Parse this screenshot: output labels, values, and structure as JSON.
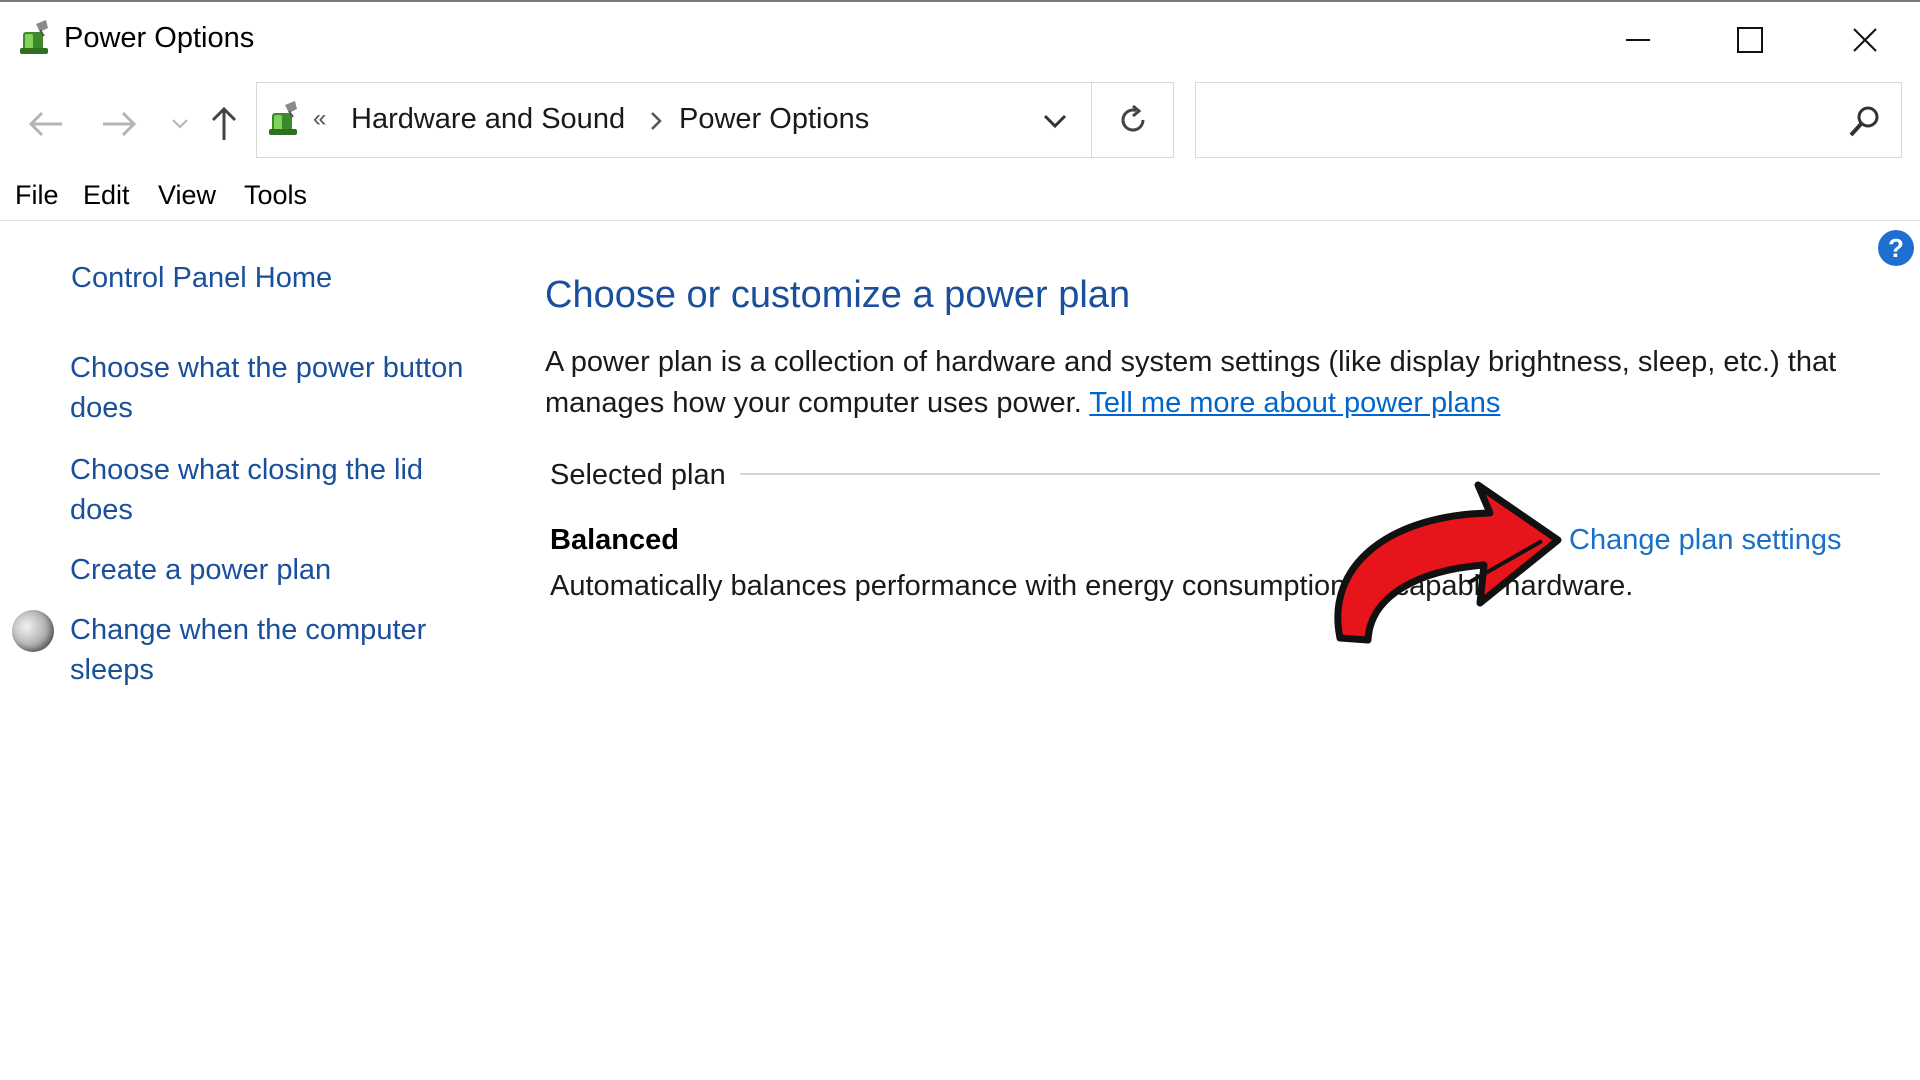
{
  "window": {
    "title": "Power Options"
  },
  "address": {
    "separator": "«",
    "breadcrumbs": [
      "Hardware and Sound",
      "Power Options"
    ],
    "search_placeholder": ""
  },
  "menu": [
    "File",
    "Edit",
    "View",
    "Tools"
  ],
  "sidebar": {
    "home": "Control Panel Home",
    "items": [
      "Choose what the power button does",
      "Choose what closing the lid does",
      "Create a power plan",
      "Change when the computer sleeps"
    ]
  },
  "main": {
    "title": "Choose or customize a power plan",
    "description": "A power plan is a collection of hardware and system settings (like display brightness, sleep, etc.) that manages how your computer uses power.",
    "learn_more": "Tell me more about power plans",
    "section_label": "Selected plan",
    "plan": {
      "name": "Balanced",
      "description": "Automatically balances performance with energy consumption on capable hardware.",
      "change_link": "Change plan settings"
    }
  },
  "help": {
    "glyph": "?"
  },
  "icons": {
    "app": "power-options-icon",
    "annotation": "red-curved-arrow",
    "accent": "#1a4f9c",
    "link": "#0066cc",
    "arrow_fill": "#e8141c"
  }
}
